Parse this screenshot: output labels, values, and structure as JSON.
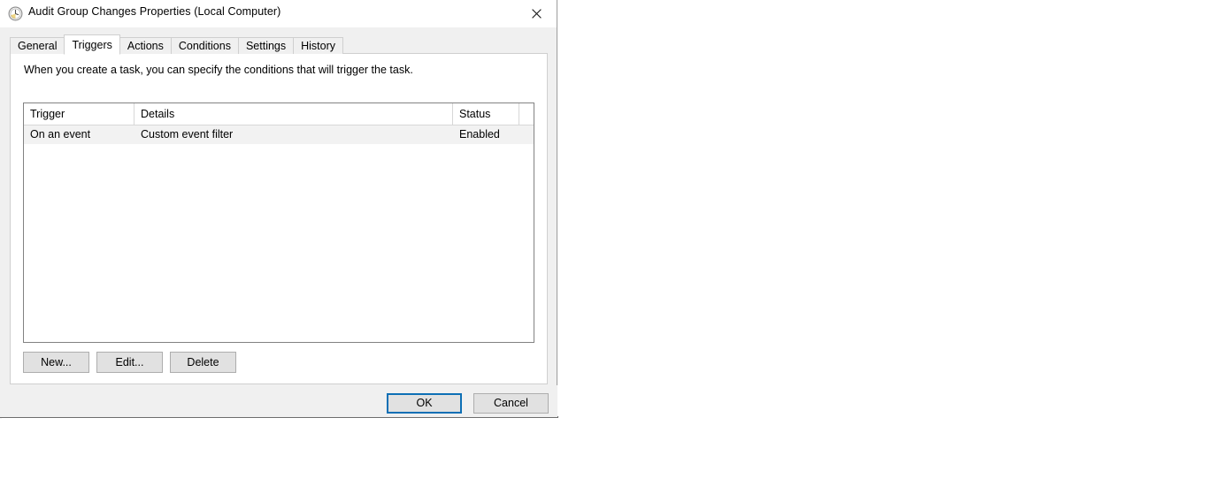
{
  "window": {
    "title": "Audit Group Changes Properties (Local Computer)",
    "icon": "clock-icon",
    "close_label": "✕"
  },
  "tabs": [
    {
      "label": "General",
      "selected": false
    },
    {
      "label": "Triggers",
      "selected": true
    },
    {
      "label": "Actions",
      "selected": false
    },
    {
      "label": "Conditions",
      "selected": false
    },
    {
      "label": "Settings",
      "selected": false
    },
    {
      "label": "History",
      "selected": false
    }
  ],
  "panel": {
    "description": "When you create a task, you can specify the conditions that will trigger the task."
  },
  "trigger_list": {
    "columns": [
      "Trigger",
      "Details",
      "Status"
    ],
    "rows": [
      {
        "trigger": "On an event",
        "details": "Custom event filter",
        "status": "Enabled"
      }
    ]
  },
  "list_actions": {
    "new_label": "New...",
    "edit_label": "Edit...",
    "delete_label": "Delete"
  },
  "footer": {
    "ok_label": "OK",
    "cancel_label": "Cancel"
  },
  "colors": {
    "accent_focus": "#0d6fb5",
    "dialog_background": "#f0f0f0",
    "panel_background": "#ffffff",
    "row_background": "#f2f2f2",
    "button_face": "#e1e1e1",
    "list_border": "#828282"
  }
}
